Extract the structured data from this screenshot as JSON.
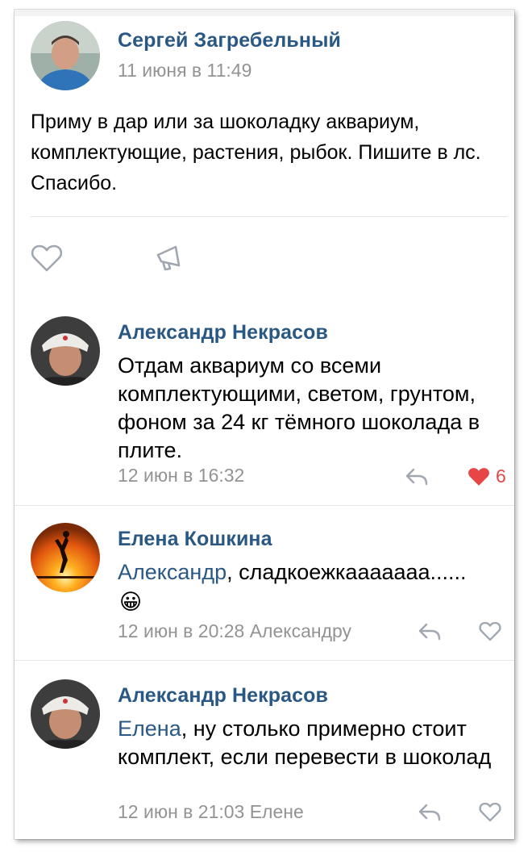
{
  "post": {
    "author": "Сергей Загребельный",
    "date": "11 июня в 11:49",
    "text": "Приму в дар или за шоколадку аквариум, комплектующие, растения, рыбок. Пишите в лс. Спасибо."
  },
  "comments": [
    {
      "author": "Александр Некрасов",
      "mention": "",
      "text": "Отдам аквариум со всеми комплектующими, светом, грунтом, фоном за 24 кг тёмного шоколада в плите.",
      "meta": "12 июн в 16:32",
      "likes": "6",
      "liked": true
    },
    {
      "author": "Елена Кошкина",
      "mention": "Александр",
      "text": ", сладкоежкааааааа......",
      "emoji": "😀",
      "meta": "12 июн в 20:28 Александру",
      "likes": "",
      "liked": false
    },
    {
      "author": "Александр Некрасов",
      "mention": "Елена",
      "text": ", ну столько примерно стоит комплект, если перевести в шоколад",
      "meta": "12 июн в 21:03 Елене",
      "likes": "",
      "liked": false
    }
  ],
  "colors": {
    "link": "#2a5885",
    "meta": "#939393",
    "icon": "#a0a7b0",
    "like_active": "#e64646"
  }
}
